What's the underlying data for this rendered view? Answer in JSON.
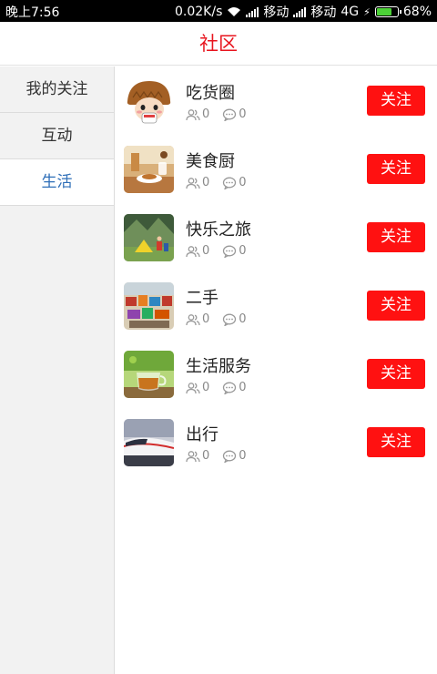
{
  "status_bar": {
    "time": "晚上7:56",
    "speed": "0.02K/s",
    "carrier1": "移动",
    "carrier2": "移动",
    "network": "4G",
    "battery": "68%",
    "battery_level": 0.68
  },
  "header": {
    "title": "社区"
  },
  "sidebar": {
    "items": [
      {
        "label": "我的关注"
      },
      {
        "label": "互动"
      },
      {
        "label": "生活"
      }
    ],
    "active_index": 2
  },
  "communities": [
    {
      "name": "吃货圈",
      "members": "0",
      "comments": "0",
      "button": "关注"
    },
    {
      "name": "美食厨",
      "members": "0",
      "comments": "0",
      "button": "关注"
    },
    {
      "name": "快乐之旅",
      "members": "0",
      "comments": "0",
      "button": "关注"
    },
    {
      "name": "二手",
      "members": "0",
      "comments": "0",
      "button": "关注"
    },
    {
      "name": "生活服务",
      "members": "0",
      "comments": "0",
      "button": "关注"
    },
    {
      "name": "出行",
      "members": "0",
      "comments": "0",
      "button": "关注"
    }
  ],
  "colors": {
    "accent_red": "#ff1111",
    "title_red": "#e8141e",
    "active_blue": "#2f6fb8",
    "sidebar_bg": "#f2f2f2"
  },
  "icons": {
    "members": "people-icon",
    "comments": "comment-icon"
  }
}
